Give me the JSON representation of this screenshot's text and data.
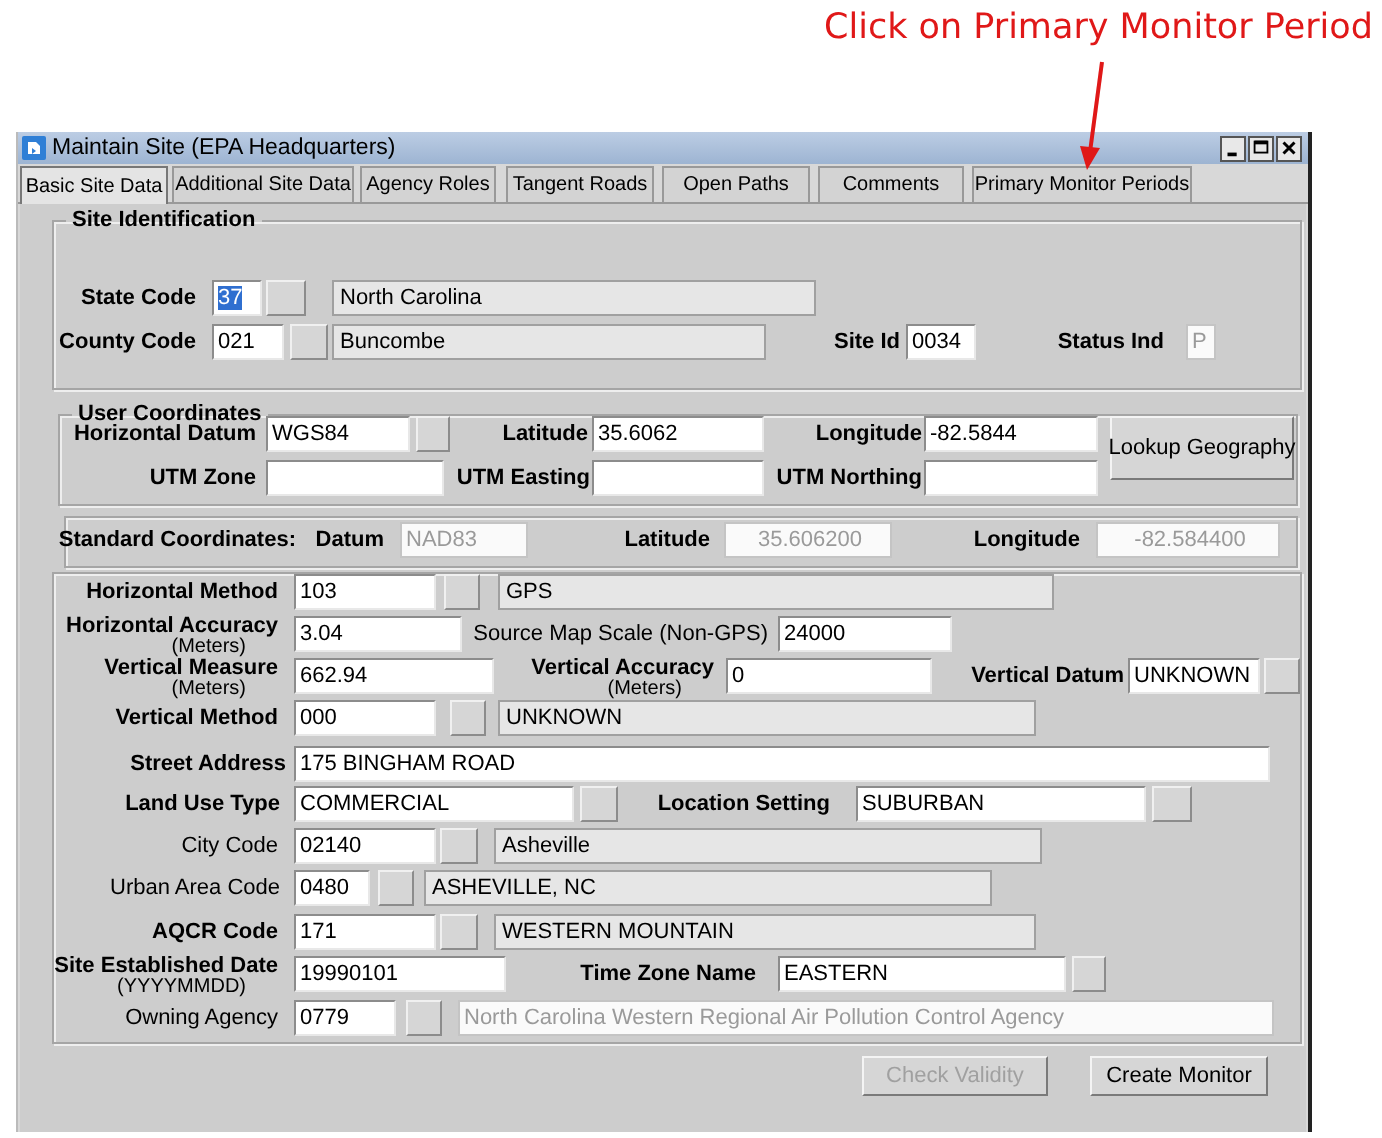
{
  "annotation": {
    "text": "Click on Primary Monitor Period"
  },
  "window": {
    "title": "Maintain Site (EPA Headquarters)"
  },
  "tabs": [
    {
      "label": "Basic Site Data",
      "selected": true
    },
    {
      "label": "Additional Site Data",
      "selected": false
    },
    {
      "label": "Agency Roles",
      "selected": false
    },
    {
      "label": "Tangent Roads",
      "selected": false
    },
    {
      "label": "Open Paths",
      "selected": false
    },
    {
      "label": "Comments",
      "selected": false
    },
    {
      "label": "Primary Monitor Periods",
      "selected": false
    }
  ],
  "sections": [
    {
      "title": "Site Identification",
      "rows": [
        [
          {
            "kind": "label",
            "text": "State Code",
            "bold": true
          },
          {
            "kind": "field",
            "value": "37",
            "disabled": false,
            "text_selected": true
          },
          {
            "kind": "lookup"
          },
          {
            "kind": "desc",
            "value": "North Carolina"
          }
        ],
        [
          {
            "kind": "label",
            "text": "County Code",
            "bold": true
          },
          {
            "kind": "field",
            "value": "021",
            "disabled": false
          },
          {
            "kind": "lookup"
          },
          {
            "kind": "desc",
            "value": "Buncombe"
          },
          {
            "kind": "label",
            "text": "Site Id",
            "bold": true
          },
          {
            "kind": "field",
            "value": "0034",
            "disabled": false
          },
          {
            "kind": "label",
            "text": "Status Ind",
            "bold": true
          },
          {
            "kind": "field",
            "value": "P",
            "disabled": true
          }
        ]
      ]
    },
    {
      "title": "User Coordinates",
      "rows": [
        [
          {
            "kind": "label",
            "text": "Horizontal Datum",
            "bold": true
          },
          {
            "kind": "field",
            "value": "WGS84",
            "disabled": false,
            "lookup": true
          },
          {
            "kind": "label",
            "text": "Latitude",
            "bold": true
          },
          {
            "kind": "field",
            "value": "35.6062",
            "disabled": false
          },
          {
            "kind": "label",
            "text": "Longitude",
            "bold": true
          },
          {
            "kind": "field",
            "value": "-82.5844",
            "disabled": false
          },
          {
            "kind": "button",
            "label": "Lookup Geography",
            "disabled": false
          }
        ],
        [
          {
            "kind": "label",
            "text": "UTM Zone",
            "bold": true
          },
          {
            "kind": "field",
            "disabled": false
          },
          {
            "kind": "label",
            "text": "UTM Easting",
            "bold": true
          },
          {
            "kind": "field",
            "disabled": false
          },
          {
            "kind": "label",
            "text": "UTM Northing",
            "bold": true
          },
          {
            "kind": "field",
            "disabled": false
          }
        ]
      ]
    },
    {
      "rows": [
        [
          {
            "kind": "label",
            "text": "Standard Coordinates:",
            "bold": true
          },
          {
            "kind": "label",
            "text": "Datum",
            "bold": true
          },
          {
            "kind": "field",
            "value": "NAD83",
            "disabled": true
          },
          {
            "kind": "label",
            "text": "Latitude",
            "bold": true
          },
          {
            "kind": "field",
            "value": "35.606200",
            "disabled": true
          },
          {
            "kind": "label",
            "text": "Longitude",
            "bold": true
          },
          {
            "kind": "field",
            "value": "-82.584400",
            "disabled": true
          }
        ]
      ]
    },
    {
      "rows": [
        [
          {
            "kind": "label",
            "text": "Horizontal Method",
            "bold": true
          },
          {
            "kind": "field",
            "value": "103",
            "disabled": false
          },
          {
            "kind": "lookup"
          },
          {
            "kind": "desc",
            "value": "GPS"
          }
        ],
        [
          {
            "kind": "label",
            "text": "Horizontal Accuracy",
            "unit": "(Meters)",
            "bold": true
          },
          {
            "kind": "field",
            "value": "3.04",
            "disabled": false
          },
          {
            "kind": "label",
            "text": "Source Map Scale (Non-GPS)",
            "bold": false
          },
          {
            "kind": "field",
            "value": "24000",
            "disabled": false
          }
        ],
        [
          {
            "kind": "label",
            "text": "Vertical Measure",
            "unit": "(Meters)",
            "bold": true
          },
          {
            "kind": "field",
            "value": "662.94",
            "disabled": false
          },
          {
            "kind": "label",
            "text": "Vertical Accuracy",
            "unit": "(Meters)",
            "bold": true
          },
          {
            "kind": "field",
            "value": "0",
            "disabled": false
          },
          {
            "kind": "label",
            "text": "Vertical Datum",
            "bold": true
          },
          {
            "kind": "field",
            "value": "UNKNOWN",
            "disabled": false
          },
          {
            "kind": "lookup"
          }
        ],
        [
          {
            "kind": "label",
            "text": "Vertical Method",
            "bold": true
          },
          {
            "kind": "field",
            "value": "000",
            "disabled": false
          },
          {
            "kind": "lookup"
          },
          {
            "kind": "desc",
            "value": "UNKNOWN"
          }
        ],
        [
          {
            "kind": "label",
            "text": "Street Address",
            "bold": true
          },
          {
            "kind": "field",
            "value": "175 BINGHAM ROAD",
            "disabled": false
          }
        ],
        [
          {
            "kind": "label",
            "text": "Land Use Type",
            "bold": true
          },
          {
            "kind": "field",
            "value": "COMMERCIAL",
            "disabled": false
          },
          {
            "kind": "lookup"
          },
          {
            "kind": "label",
            "text": "Location Setting",
            "bold": true
          },
          {
            "kind": "field",
            "value": "SUBURBAN",
            "disabled": false
          },
          {
            "kind": "lookup"
          }
        ],
        [
          {
            "kind": "label",
            "text": "City Code",
            "bold": false
          },
          {
            "kind": "field",
            "value": "02140",
            "disabled": false
          },
          {
            "kind": "lookup"
          },
          {
            "kind": "desc",
            "value": "Asheville"
          }
        ],
        [
          {
            "kind": "label",
            "text": "Urban Area Code",
            "bold": false
          },
          {
            "kind": "field",
            "value": "0480",
            "disabled": false
          },
          {
            "kind": "lookup"
          },
          {
            "kind": "desc",
            "value": "ASHEVILLE, NC"
          }
        ],
        [
          {
            "kind": "label",
            "text": "AQCR Code",
            "bold": true
          },
          {
            "kind": "field",
            "value": "171",
            "disabled": false
          },
          {
            "kind": "lookup"
          },
          {
            "kind": "desc",
            "value": "WESTERN MOUNTAIN"
          }
        ],
        [
          {
            "kind": "label",
            "text": "Site Established Date",
            "unit": "(YYYYMMDD)",
            "bold": true
          },
          {
            "kind": "field",
            "value": "19990101",
            "disabled": false
          },
          {
            "kind": "label",
            "text": "Time Zone Name",
            "bold": true
          },
          {
            "kind": "field",
            "value": "EASTERN",
            "disabled": false
          },
          {
            "kind": "lookup"
          }
        ],
        [
          {
            "kind": "label",
            "text": "Owning Agency",
            "bold": false
          },
          {
            "kind": "field",
            "value": "0779",
            "disabled": false
          },
          {
            "kind": "lookup"
          },
          {
            "kind": "field",
            "value": "North Carolina Western Regional Air Pollution Control Agency",
            "disabled": true
          }
        ]
      ]
    }
  ],
  "buttons": [
    {
      "label": "Check Validity",
      "disabled": true
    },
    {
      "label": "Create Monitor",
      "disabled": false
    }
  ]
}
